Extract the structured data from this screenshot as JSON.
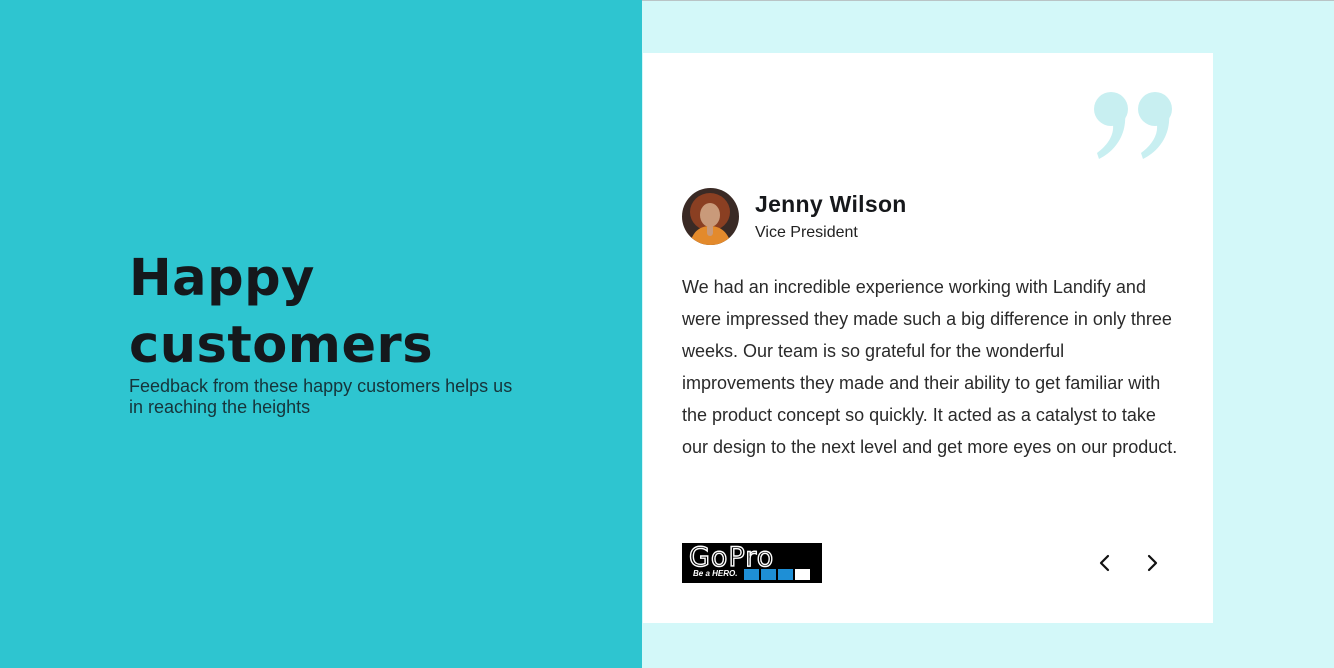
{
  "hero": {
    "title": "Happy customers",
    "subtitle": "Feedback from these happy customers helps us in reaching the heights"
  },
  "testimonial": {
    "name": "Jenny Wilson",
    "role": "Vice President",
    "text": "We had an incredible experience working with Landify and were impressed they made such a big difference in only three weeks. Our team is so grateful for the wonderful improvements they made and their ability to get familiar with the product concept so quickly. It acted as a catalyst to take our design to the next level and get more eyes on our product.",
    "logo": {
      "wordmark": "GoPro",
      "tagline": "Be a HERO."
    }
  },
  "icons": {
    "quote": "quote-icon",
    "prev": "chevron-left-icon",
    "next": "chevron-right-icon"
  },
  "colors": {
    "left_bg": "#2ec5d0",
    "right_bg": "#d3f8f9",
    "card_bg": "#ffffff",
    "quote": "#c8eff1",
    "logo_squares": [
      "#1e8fd6",
      "#1e8fd6",
      "#1e8fd6",
      "#ffffff"
    ]
  }
}
